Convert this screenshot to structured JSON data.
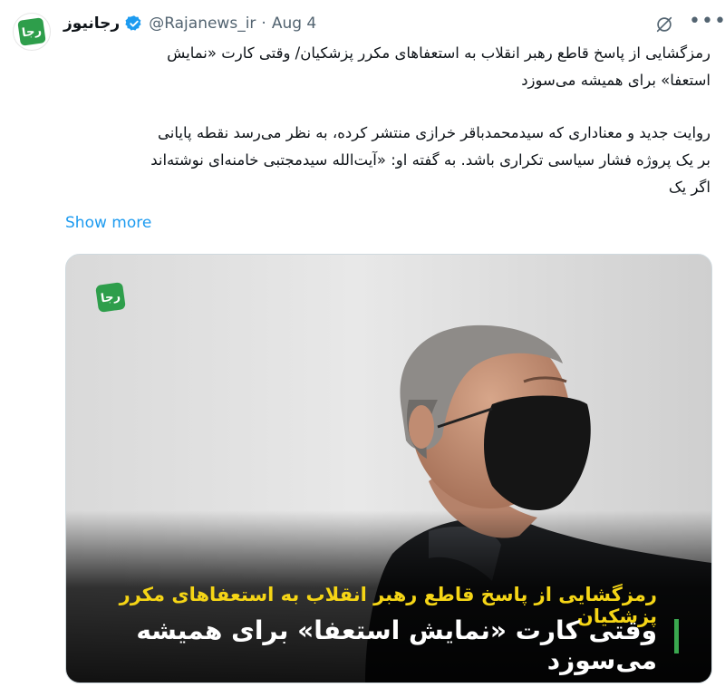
{
  "tweet": {
    "author_name": "رجانیوز",
    "handle": "@Rajanews_ir",
    "separator": "·",
    "date": "Aug 4",
    "avatar_text": "رجا",
    "headline_line1": "رمزگشایی از پاسخ قاطع رهبر انقلاب به استعفاهای مکرر پزشکیان/ وقتی کارت «نمایش",
    "headline_line2": "استعفا» برای همیشه می‌سوزد",
    "body_line1": "روایت جدید و معناداری که سیدمحمدباقر خرازی منتشر کرده، به نظر می‌رسد نقطه پایانی",
    "body_line2": "بر یک پروژه فشار سیاسی تکراری باشد. به گفته او: «آیت‌الله سیدمجتبی خامنه‌ای نوشته‌اند",
    "body_line3": "اگر یک",
    "show_more": "Show more"
  },
  "media": {
    "logo_text": "رجا",
    "caption_top": "رمزگشایی از پاسخ قاطع رهبر انقلاب به استعفاهای مکرر پزشکیان",
    "caption_bottom": "وقتی کارت «نمایش استعفا» برای همیشه می‌سوزد"
  },
  "icons": {
    "verified": "verified-badge-icon",
    "grok": "grok-icon",
    "more": "more-options-icon"
  },
  "colors": {
    "link": "#1d9bf0",
    "brand_green": "#2e9e4b",
    "caption_yellow": "#f5d516"
  }
}
